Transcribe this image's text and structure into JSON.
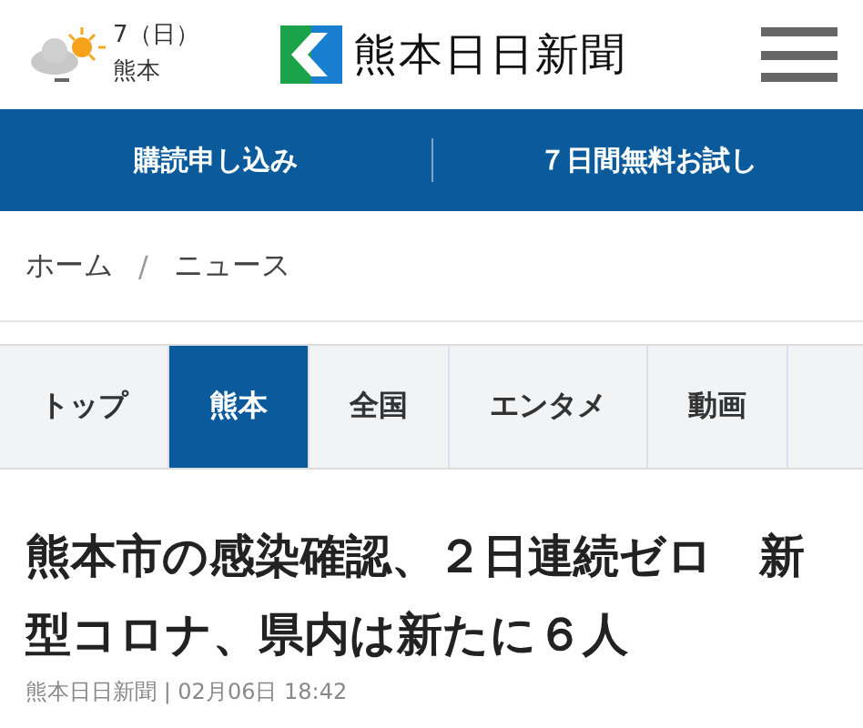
{
  "weather": {
    "date": "7（日）",
    "place": "熊本"
  },
  "logo": {
    "name": "熊本日日新聞"
  },
  "promo_bar": {
    "items": [
      "購読申し込み",
      "７日間無料お試し"
    ]
  },
  "breadcrumb": [
    "ホーム",
    "/",
    "ニュース"
  ],
  "tabs": [
    {
      "label": "トップ",
      "selected": false
    },
    {
      "label": "熊本",
      "selected": true
    },
    {
      "label": "全国",
      "selected": false
    },
    {
      "label": "エンタメ",
      "selected": false
    },
    {
      "label": "動画",
      "selected": false
    }
  ],
  "article": {
    "headline": "熊本市の感染確認、２日連続ゼロ　新型コロナ、県内は新たに６人",
    "byline": "熊本日日新聞 | 02月06日 18:42"
  }
}
